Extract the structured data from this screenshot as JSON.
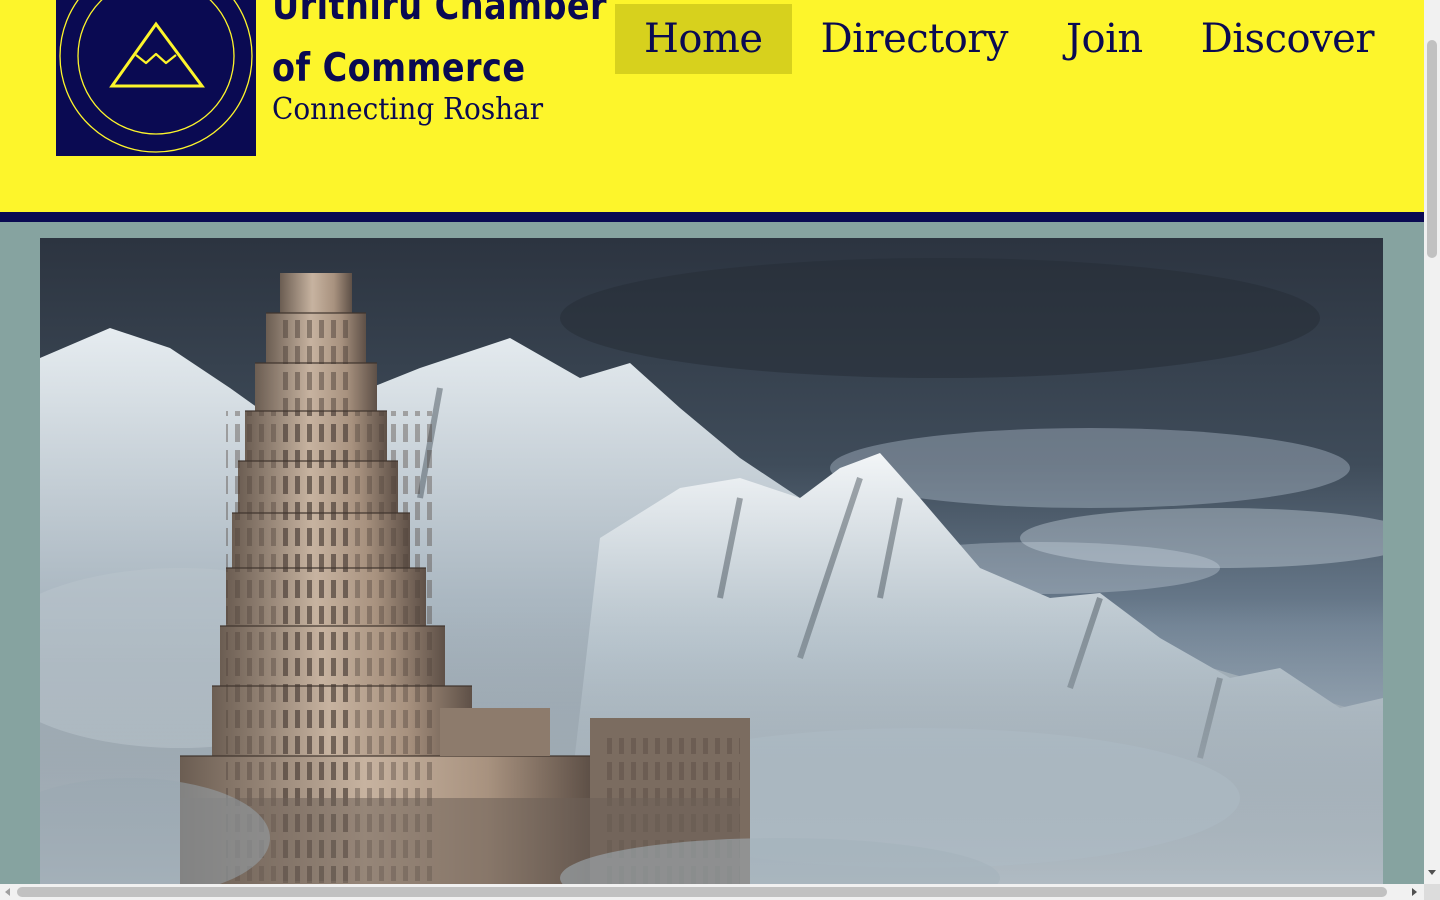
{
  "brand": {
    "title_line1": "Urithiru Chamber",
    "title_line2": "of Commerce",
    "tagline": "Connecting Roshar",
    "logo_icon": "mountain-icon"
  },
  "nav": {
    "items": [
      {
        "label": "Home",
        "active": true
      },
      {
        "label": "Directory",
        "active": false
      },
      {
        "label": "Join",
        "active": false
      },
      {
        "label": "Discover",
        "active": false
      }
    ]
  },
  "hero": {
    "image_alt": ""
  },
  "colors": {
    "header_bg": "#fdf52b",
    "brand_navy": "#0a0a52",
    "active_nav_bg": "#d7d11d",
    "page_bg": "#86a3a0"
  }
}
